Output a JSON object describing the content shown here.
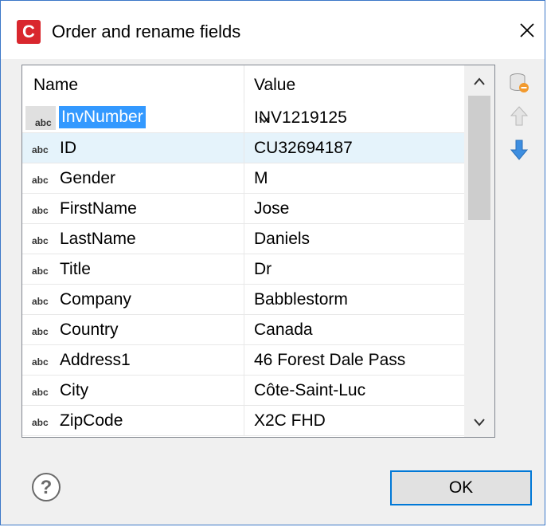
{
  "window": {
    "title": "Order and rename fields",
    "app_icon_letter": "C",
    "accent_color": "#d9272e"
  },
  "grid": {
    "headers": [
      "Name",
      "Value"
    ],
    "type_label": "abc",
    "editing": {
      "name": "InvNumber",
      "value": "INV1219125"
    },
    "rows": [
      {
        "name": "ID",
        "value": "CU32694187"
      },
      {
        "name": "Gender",
        "value": "M"
      },
      {
        "name": "FirstName",
        "value": "Jose"
      },
      {
        "name": "LastName",
        "value": "Daniels"
      },
      {
        "name": "Title",
        "value": "Dr"
      },
      {
        "name": "Company",
        "value": "Babblestorm"
      },
      {
        "name": "Country",
        "value": "Canada"
      },
      {
        "name": "Address1",
        "value": "46 Forest Dale Pass"
      },
      {
        "name": "City",
        "value": "Côte-Saint-Luc"
      },
      {
        "name": "ZipCode",
        "value": "X2C FHD"
      }
    ],
    "selected_row_color": "#e5f3fb"
  },
  "footer": {
    "ok_label": "OK"
  }
}
